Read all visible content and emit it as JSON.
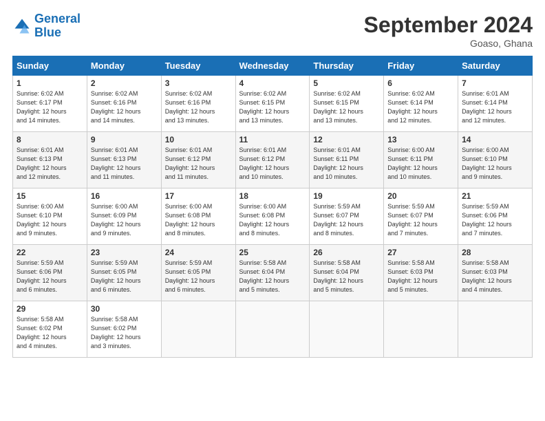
{
  "header": {
    "logo_line1": "General",
    "logo_line2": "Blue",
    "month": "September 2024",
    "location": "Goaso, Ghana"
  },
  "days_of_week": [
    "Sunday",
    "Monday",
    "Tuesday",
    "Wednesday",
    "Thursday",
    "Friday",
    "Saturday"
  ],
  "weeks": [
    [
      {
        "day": "1",
        "info": "Sunrise: 6:02 AM\nSunset: 6:17 PM\nDaylight: 12 hours\nand 14 minutes."
      },
      {
        "day": "2",
        "info": "Sunrise: 6:02 AM\nSunset: 6:16 PM\nDaylight: 12 hours\nand 14 minutes."
      },
      {
        "day": "3",
        "info": "Sunrise: 6:02 AM\nSunset: 6:16 PM\nDaylight: 12 hours\nand 13 minutes."
      },
      {
        "day": "4",
        "info": "Sunrise: 6:02 AM\nSunset: 6:15 PM\nDaylight: 12 hours\nand 13 minutes."
      },
      {
        "day": "5",
        "info": "Sunrise: 6:02 AM\nSunset: 6:15 PM\nDaylight: 12 hours\nand 13 minutes."
      },
      {
        "day": "6",
        "info": "Sunrise: 6:02 AM\nSunset: 6:14 PM\nDaylight: 12 hours\nand 12 minutes."
      },
      {
        "day": "7",
        "info": "Sunrise: 6:01 AM\nSunset: 6:14 PM\nDaylight: 12 hours\nand 12 minutes."
      }
    ],
    [
      {
        "day": "8",
        "info": "Sunrise: 6:01 AM\nSunset: 6:13 PM\nDaylight: 12 hours\nand 12 minutes."
      },
      {
        "day": "9",
        "info": "Sunrise: 6:01 AM\nSunset: 6:13 PM\nDaylight: 12 hours\nand 11 minutes."
      },
      {
        "day": "10",
        "info": "Sunrise: 6:01 AM\nSunset: 6:12 PM\nDaylight: 12 hours\nand 11 minutes."
      },
      {
        "day": "11",
        "info": "Sunrise: 6:01 AM\nSunset: 6:12 PM\nDaylight: 12 hours\nand 10 minutes."
      },
      {
        "day": "12",
        "info": "Sunrise: 6:01 AM\nSunset: 6:11 PM\nDaylight: 12 hours\nand 10 minutes."
      },
      {
        "day": "13",
        "info": "Sunrise: 6:00 AM\nSunset: 6:11 PM\nDaylight: 12 hours\nand 10 minutes."
      },
      {
        "day": "14",
        "info": "Sunrise: 6:00 AM\nSunset: 6:10 PM\nDaylight: 12 hours\nand 9 minutes."
      }
    ],
    [
      {
        "day": "15",
        "info": "Sunrise: 6:00 AM\nSunset: 6:10 PM\nDaylight: 12 hours\nand 9 minutes."
      },
      {
        "day": "16",
        "info": "Sunrise: 6:00 AM\nSunset: 6:09 PM\nDaylight: 12 hours\nand 9 minutes."
      },
      {
        "day": "17",
        "info": "Sunrise: 6:00 AM\nSunset: 6:08 PM\nDaylight: 12 hours\nand 8 minutes."
      },
      {
        "day": "18",
        "info": "Sunrise: 6:00 AM\nSunset: 6:08 PM\nDaylight: 12 hours\nand 8 minutes."
      },
      {
        "day": "19",
        "info": "Sunrise: 5:59 AM\nSunset: 6:07 PM\nDaylight: 12 hours\nand 8 minutes."
      },
      {
        "day": "20",
        "info": "Sunrise: 5:59 AM\nSunset: 6:07 PM\nDaylight: 12 hours\nand 7 minutes."
      },
      {
        "day": "21",
        "info": "Sunrise: 5:59 AM\nSunset: 6:06 PM\nDaylight: 12 hours\nand 7 minutes."
      }
    ],
    [
      {
        "day": "22",
        "info": "Sunrise: 5:59 AM\nSunset: 6:06 PM\nDaylight: 12 hours\nand 6 minutes."
      },
      {
        "day": "23",
        "info": "Sunrise: 5:59 AM\nSunset: 6:05 PM\nDaylight: 12 hours\nand 6 minutes."
      },
      {
        "day": "24",
        "info": "Sunrise: 5:59 AM\nSunset: 6:05 PM\nDaylight: 12 hours\nand 6 minutes."
      },
      {
        "day": "25",
        "info": "Sunrise: 5:58 AM\nSunset: 6:04 PM\nDaylight: 12 hours\nand 5 minutes."
      },
      {
        "day": "26",
        "info": "Sunrise: 5:58 AM\nSunset: 6:04 PM\nDaylight: 12 hours\nand 5 minutes."
      },
      {
        "day": "27",
        "info": "Sunrise: 5:58 AM\nSunset: 6:03 PM\nDaylight: 12 hours\nand 5 minutes."
      },
      {
        "day": "28",
        "info": "Sunrise: 5:58 AM\nSunset: 6:03 PM\nDaylight: 12 hours\nand 4 minutes."
      }
    ],
    [
      {
        "day": "29",
        "info": "Sunrise: 5:58 AM\nSunset: 6:02 PM\nDaylight: 12 hours\nand 4 minutes."
      },
      {
        "day": "30",
        "info": "Sunrise: 5:58 AM\nSunset: 6:02 PM\nDaylight: 12 hours\nand 3 minutes."
      },
      null,
      null,
      null,
      null,
      null
    ]
  ]
}
